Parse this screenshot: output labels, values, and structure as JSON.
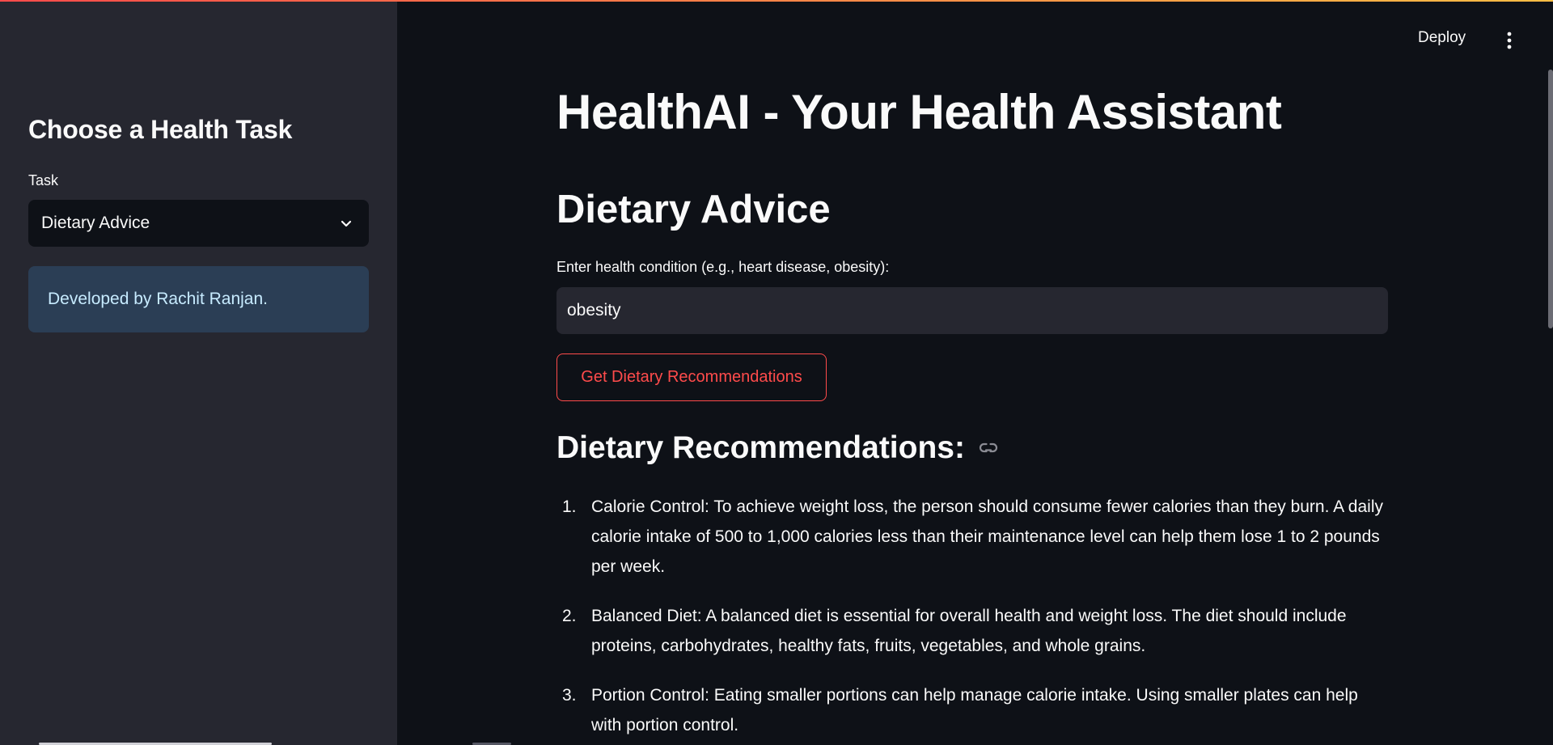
{
  "sidebar": {
    "title": "Choose a Health Task",
    "task_label": "Task",
    "task_selected": "Dietary Advice",
    "info_text": "Developed by Rachit Ranjan."
  },
  "header": {
    "deploy_label": "Deploy"
  },
  "main": {
    "title": "HealthAI - Your Health Assistant",
    "section_title": "Dietary Advice",
    "input_label": "Enter health condition (e.g., heart disease, obesity):",
    "input_value": "obesity",
    "button_label": "Get Dietary Recommendations",
    "results_title": "Dietary Recommendations:",
    "recommendations": [
      {
        "num": "1.",
        "text": "Calorie Control: To achieve weight loss, the person should consume fewer calories than they burn. A daily calorie intake of 500 to 1,000 calories less than their maintenance level can help them lose 1 to 2 pounds per week."
      },
      {
        "num": "2.",
        "text": "Balanced Diet: A balanced diet is essential for overall health and weight loss. The diet should include proteins, carbohydrates, healthy fats, fruits, vegetables, and whole grains."
      },
      {
        "num": "3.",
        "text": "Portion Control: Eating smaller portions can help manage calorie intake. Using smaller plates can help with portion control."
      }
    ]
  },
  "colors": {
    "background": "#0e1117",
    "sidebar": "#262730",
    "accent": "#ff4b4b",
    "info_bg": "#2b3e55",
    "info_text": "#c7ebff"
  },
  "icons": [
    "chevron-down-icon",
    "more-vertical-icon",
    "link-icon"
  ]
}
